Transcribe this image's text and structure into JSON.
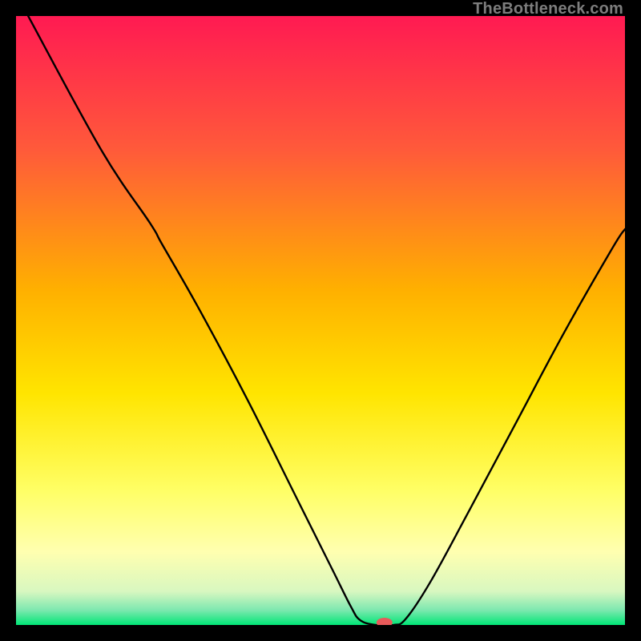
{
  "watermark": "TheBottleneck.com",
  "chart_data": {
    "type": "line",
    "title": "",
    "xlabel": "",
    "ylabel": "",
    "xlim": [
      0,
      100
    ],
    "ylim": [
      0,
      100
    ],
    "grid": false,
    "legend": false,
    "background_gradient": {
      "stops": [
        {
          "offset": 0.0,
          "color": "#ff1a52"
        },
        {
          "offset": 0.22,
          "color": "#ff5a3a"
        },
        {
          "offset": 0.45,
          "color": "#ffb000"
        },
        {
          "offset": 0.62,
          "color": "#ffe500"
        },
        {
          "offset": 0.78,
          "color": "#ffff66"
        },
        {
          "offset": 0.88,
          "color": "#ffffb0"
        },
        {
          "offset": 0.945,
          "color": "#d8f7c0"
        },
        {
          "offset": 0.975,
          "color": "#7fe8b0"
        },
        {
          "offset": 1.0,
          "color": "#00e676"
        }
      ]
    },
    "series": [
      {
        "name": "bottleneck-curve",
        "points": [
          {
            "x": 2.0,
            "y": 100.0
          },
          {
            "x": 14.0,
            "y": 78.0
          },
          {
            "x": 22.0,
            "y": 66.0
          },
          {
            "x": 24.0,
            "y": 62.5
          },
          {
            "x": 30.0,
            "y": 52.0
          },
          {
            "x": 38.0,
            "y": 37.0
          },
          {
            "x": 46.0,
            "y": 21.0
          },
          {
            "x": 52.0,
            "y": 9.0
          },
          {
            "x": 55.0,
            "y": 3.0
          },
          {
            "x": 56.5,
            "y": 0.8
          },
          {
            "x": 59.0,
            "y": 0.0
          },
          {
            "x": 62.0,
            "y": 0.0
          },
          {
            "x": 64.0,
            "y": 1.0
          },
          {
            "x": 68.0,
            "y": 7.0
          },
          {
            "x": 74.0,
            "y": 18.0
          },
          {
            "x": 82.0,
            "y": 33.0
          },
          {
            "x": 90.0,
            "y": 48.0
          },
          {
            "x": 98.0,
            "y": 62.0
          },
          {
            "x": 100.0,
            "y": 65.0
          }
        ]
      }
    ],
    "marker": {
      "name": "optimal-marker",
      "x": 60.5,
      "y": 0.0,
      "color": "#e85a5a",
      "rx": 10,
      "ry": 6
    }
  }
}
